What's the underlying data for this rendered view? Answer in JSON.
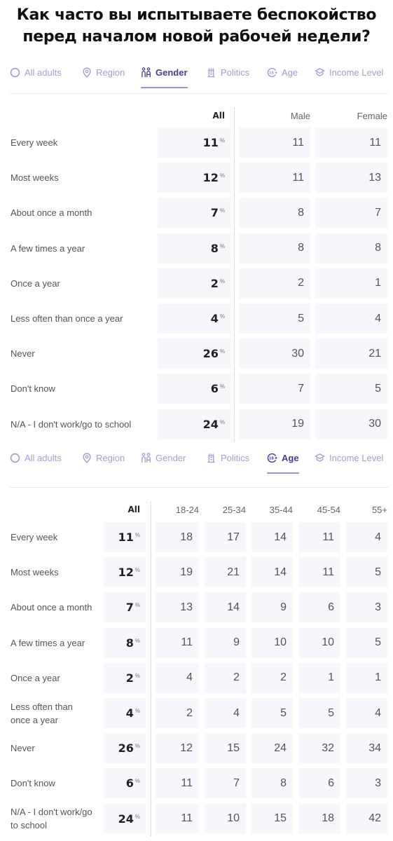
{
  "title": "Как часто вы испытываете беспокойство перед началом новой рабочей недели?",
  "accent_color": "#4b3a96",
  "tab_color": "#a99ad8",
  "tabs": [
    {
      "label": "All adults",
      "icon": "circle-icon"
    },
    {
      "label": "Region",
      "icon": "map-pin-icon"
    },
    {
      "label": "Gender",
      "icon": "gender-icon"
    },
    {
      "label": "Politics",
      "icon": "politics-icon"
    },
    {
      "label": "Age",
      "icon": "age-18plus-icon"
    },
    {
      "label": "Income Level",
      "icon": "income-icon"
    }
  ],
  "gender_table": {
    "active_tab": "Gender",
    "headers": [
      "All",
      "Male",
      "Female"
    ],
    "pct_symbol": "%",
    "rows": [
      {
        "label": "Every week",
        "all": "11",
        "values": [
          "11",
          "11"
        ]
      },
      {
        "label": "Most weeks",
        "all": "12",
        "values": [
          "11",
          "13"
        ]
      },
      {
        "label": "About once a month",
        "all": "7",
        "values": [
          "8",
          "7"
        ]
      },
      {
        "label": "A few times a year",
        "all": "8",
        "values": [
          "8",
          "8"
        ]
      },
      {
        "label": "Once a year",
        "all": "2",
        "values": [
          "2",
          "1"
        ]
      },
      {
        "label": "Less often than once a year",
        "all": "4",
        "values": [
          "5",
          "4"
        ]
      },
      {
        "label": "Never",
        "all": "26",
        "values": [
          "30",
          "21"
        ]
      },
      {
        "label": "Don't know",
        "all": "6",
        "values": [
          "7",
          "5"
        ]
      },
      {
        "label": "N/A - I don't work/go to school",
        "all": "24",
        "values": [
          "19",
          "30"
        ]
      }
    ]
  },
  "age_table": {
    "active_tab": "Age",
    "headers": [
      "All",
      "18-24",
      "25-34",
      "35-44",
      "45-54",
      "55+"
    ],
    "pct_symbol": "%",
    "rows": [
      {
        "label": "Every week",
        "all": "11",
        "values": [
          "18",
          "17",
          "14",
          "11",
          "4"
        ]
      },
      {
        "label": "Most weeks",
        "all": "12",
        "values": [
          "19",
          "21",
          "14",
          "11",
          "5"
        ]
      },
      {
        "label": "About once a month",
        "all": "7",
        "values": [
          "13",
          "14",
          "9",
          "6",
          "3"
        ]
      },
      {
        "label": "A few times a year",
        "all": "8",
        "values": [
          "11",
          "9",
          "10",
          "10",
          "5"
        ]
      },
      {
        "label": "Once a year",
        "all": "2",
        "values": [
          "4",
          "2",
          "2",
          "1",
          "1"
        ]
      },
      {
        "label": "Less often than once a year",
        "all": "4",
        "values": [
          "2",
          "4",
          "5",
          "5",
          "4"
        ]
      },
      {
        "label": "Never",
        "all": "26",
        "values": [
          "12",
          "15",
          "24",
          "32",
          "34"
        ]
      },
      {
        "label": "Don't know",
        "all": "6",
        "values": [
          "11",
          "7",
          "8",
          "6",
          "3"
        ]
      },
      {
        "label": "N/A - I don't work/go to school",
        "all": "24",
        "values": [
          "11",
          "10",
          "15",
          "18",
          "42"
        ]
      }
    ]
  }
}
